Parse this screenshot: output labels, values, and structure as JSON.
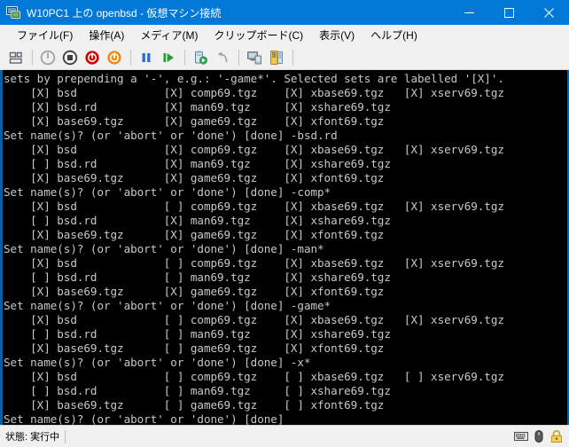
{
  "window": {
    "title": "W10PC1 上の openbsd - 仮想マシン接続",
    "icon_name": "virtual-machine-icon",
    "controls": {
      "minimize": "─",
      "maximize": "□",
      "close": "✕"
    },
    "accent_color": "#0078d7",
    "chrome_color": "#f0f0f0"
  },
  "menubar": {
    "items": [
      {
        "label": "ファイル(F)"
      },
      {
        "label": "操作(A)"
      },
      {
        "label": "メディア(M)"
      },
      {
        "label": "クリップボード(C)"
      },
      {
        "label": "表示(V)"
      },
      {
        "label": "ヘルプ(H)"
      }
    ]
  },
  "toolbar": {
    "items": [
      {
        "name": "ctrl-alt-del-button",
        "kind": "icon"
      },
      {
        "name": "separator-1",
        "kind": "sep"
      },
      {
        "name": "start-button",
        "kind": "icon"
      },
      {
        "name": "turn-off-button",
        "kind": "icon"
      },
      {
        "name": "shut-down-button",
        "kind": "icon"
      },
      {
        "name": "save-state-button",
        "kind": "icon"
      },
      {
        "name": "separator-2",
        "kind": "sep"
      },
      {
        "name": "pause-button",
        "kind": "icon"
      },
      {
        "name": "reset-button",
        "kind": "icon"
      },
      {
        "name": "separator-3",
        "kind": "sep"
      },
      {
        "name": "checkpoint-button",
        "kind": "icon"
      },
      {
        "name": "revert-button",
        "kind": "icon"
      },
      {
        "name": "separator-4",
        "kind": "sep"
      },
      {
        "name": "enhanced-session-button",
        "kind": "icon"
      },
      {
        "name": "settings-button",
        "kind": "icon"
      },
      {
        "name": "separator-5",
        "kind": "sep"
      }
    ]
  },
  "terminal": {
    "background": "#000000",
    "foreground": "#c8c8c8",
    "border_color": "#0b5fa5",
    "lines": [
      "sets by prepending a '-', e.g.: '-game*'. Selected sets are labelled '[X]'.",
      "    [X] bsd             [X] comp69.tgz    [X] xbase69.tgz   [X] xserv69.tgz",
      "    [X] bsd.rd          [X] man69.tgz     [X] xshare69.tgz",
      "    [X] base69.tgz      [X] game69.tgz    [X] xfont69.tgz",
      "Set name(s)? (or 'abort' or 'done') [done] -bsd.rd",
      "    [X] bsd             [X] comp69.tgz    [X] xbase69.tgz   [X] xserv69.tgz",
      "    [ ] bsd.rd          [X] man69.tgz     [X] xshare69.tgz",
      "    [X] base69.tgz      [X] game69.tgz    [X] xfont69.tgz",
      "Set name(s)? (or 'abort' or 'done') [done] -comp*",
      "    [X] bsd             [ ] comp69.tgz    [X] xbase69.tgz   [X] xserv69.tgz",
      "    [ ] bsd.rd          [X] man69.tgz     [X] xshare69.tgz",
      "    [X] base69.tgz      [X] game69.tgz    [X] xfont69.tgz",
      "Set name(s)? (or 'abort' or 'done') [done] -man*",
      "    [X] bsd             [ ] comp69.tgz    [X] xbase69.tgz   [X] xserv69.tgz",
      "    [ ] bsd.rd          [ ] man69.tgz     [X] xshare69.tgz",
      "    [X] base69.tgz      [X] game69.tgz    [X] xfont69.tgz",
      "Set name(s)? (or 'abort' or 'done') [done] -game*",
      "    [X] bsd             [ ] comp69.tgz    [X] xbase69.tgz   [X] xserv69.tgz",
      "    [ ] bsd.rd          [ ] man69.tgz     [X] xshare69.tgz",
      "    [X] base69.tgz      [ ] game69.tgz    [X] xfont69.tgz",
      "Set name(s)? (or 'abort' or 'done') [done] -x*",
      "    [X] bsd             [ ] comp69.tgz    [ ] xbase69.tgz   [ ] xserv69.tgz",
      "    [ ] bsd.rd          [ ] man69.tgz     [ ] xshare69.tgz",
      "    [X] base69.tgz      [ ] game69.tgz    [ ] xfont69.tgz",
      "Set name(s)? (or 'abort' or 'done') [done]"
    ]
  },
  "statusbar": {
    "status_label": "状態: 実行中",
    "icons": [
      {
        "name": "keyboard-icon"
      },
      {
        "name": "mouse-icon"
      },
      {
        "name": "lock-icon"
      }
    ]
  }
}
